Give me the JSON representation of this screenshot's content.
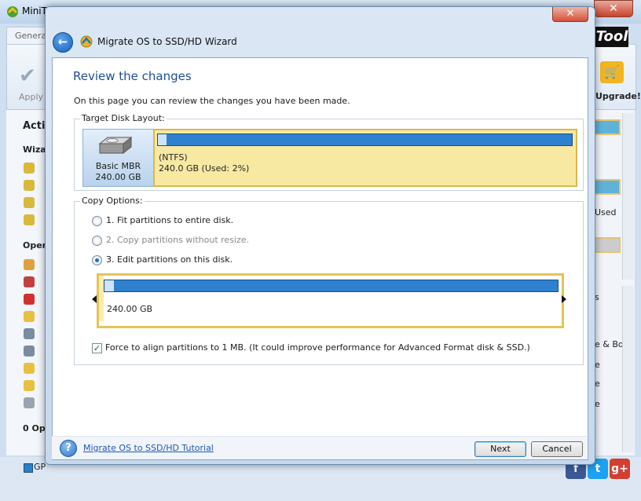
{
  "background_window": {
    "title": "MiniT",
    "tab": "Genera",
    "apply_label": "Apply",
    "left_headings": [
      "Actio",
      "Wizar",
      "Opera",
      "0 Ope"
    ],
    "right_texts": [
      "Upgrade!",
      "Used",
      "s",
      "e & Bo.",
      "e",
      "e",
      "e"
    ],
    "legend_text": "GP"
  },
  "dialog": {
    "title": "Migrate OS to SSD/HD Wizard",
    "close_glyph": "✕",
    "page_title": "Review the changes",
    "page_description": "On this page you can review the changes you have been made.",
    "target_group_label": "Target Disk Layout:",
    "disk": {
      "type": "Basic MBR",
      "size": "240.00 GB"
    },
    "partition": {
      "name": "(NTFS)",
      "info": "240.0 GB (Used: 2%)",
      "used_fraction": 0.02
    },
    "copy_group_label": "Copy Options:",
    "options": [
      {
        "label": "1. Fit partitions to entire disk.",
        "checked": false,
        "enabled": true
      },
      {
        "label": "2. Copy partitions without resize.",
        "checked": false,
        "enabled": false
      },
      {
        "label": "3. Edit partitions on this disk.",
        "checked": true,
        "enabled": true
      }
    ],
    "edit_partition_size": "240.00 GB",
    "align_checkbox": {
      "checked": true,
      "label": "Force to align partitions to 1 MB.  (It could improve performance for Advanced Format disk & SSD.)"
    },
    "footer": {
      "tutorial_link": "Migrate OS to SSD/HD Tutorial",
      "next_label": "Next",
      "cancel_label": "Cancel"
    }
  },
  "colors": {
    "accent_blue": "#2f80cf",
    "title_blue": "#1e4e96",
    "partition_yellow": "#f8e9a2"
  }
}
